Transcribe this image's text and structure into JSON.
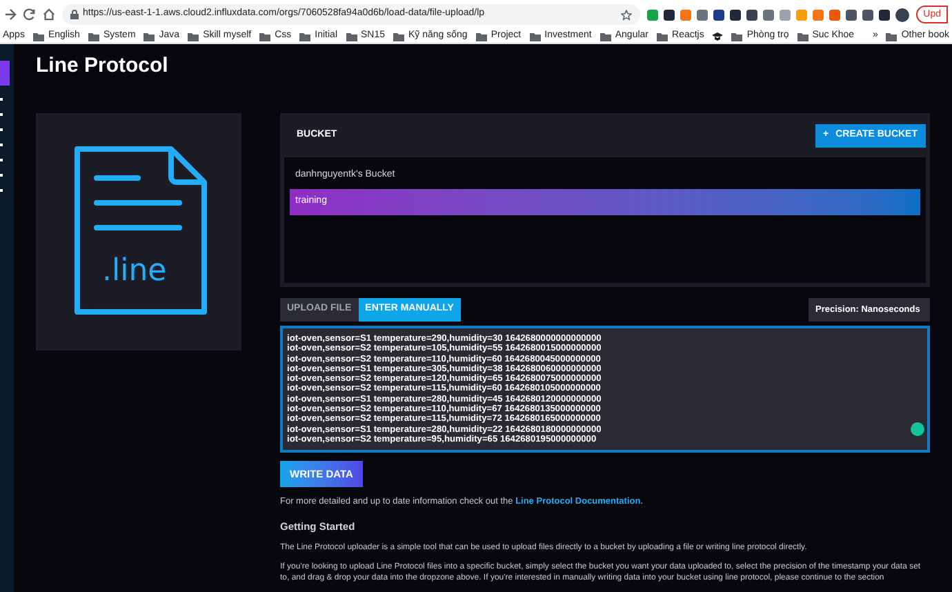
{
  "browser": {
    "url": "https://us-east-1-1.aws.cloud2.influxdata.com/orgs/7060528fa94a0d6b/load-data/file-upload/lp",
    "update_label": "Upd",
    "bookmarks": [
      {
        "label": "Apps",
        "kind": "apps"
      },
      {
        "label": "English",
        "kind": "folder"
      },
      {
        "label": "System",
        "kind": "folder"
      },
      {
        "label": "Java",
        "kind": "folder"
      },
      {
        "label": "Skill myself",
        "kind": "folder"
      },
      {
        "label": "Css",
        "kind": "folder"
      },
      {
        "label": "Initial",
        "kind": "folder"
      },
      {
        "label": "SN15",
        "kind": "folder"
      },
      {
        "label": "Kỹ năng sống",
        "kind": "folder"
      },
      {
        "label": "Project",
        "kind": "folder"
      },
      {
        "label": "Investment",
        "kind": "folder"
      },
      {
        "label": "Angular",
        "kind": "folder"
      },
      {
        "label": "Reactjs",
        "kind": "folder"
      },
      {
        "kind": "cap"
      },
      {
        "label": "Phòng trọ",
        "kind": "folder"
      },
      {
        "label": "Suc Khoe",
        "kind": "folder"
      }
    ],
    "overflow": "»",
    "other_bookmarks": "Other book"
  },
  "page": {
    "title": "Line Protocol",
    "file_label": ".line",
    "bucket": {
      "heading": "BUCKET",
      "create_button": "CREATE BUCKET",
      "create_icon": "+",
      "items": [
        {
          "label": "danhnguyentk's Bucket",
          "selected": false
        },
        {
          "label": "training",
          "selected": true
        }
      ]
    },
    "tabs": [
      {
        "label": "UPLOAD FILE",
        "selected": false
      },
      {
        "label": "ENTER MANUALLY",
        "selected": true
      }
    ],
    "precision": "Precision: Nanoseconds",
    "lines": [
      "iot-oven,sensor=S1 temperature=290,humidity=30 1642680000000000000",
      "iot-oven,sensor=S2 temperature=105,humidity=55 1642680015000000000",
      "iot-oven,sensor=S2 temperature=110,humidity=60 1642680045000000000",
      "iot-oven,sensor=S1 temperature=305,humidity=38 1642680060000000000",
      "iot-oven,sensor=S2 temperature=120,humidity=65 1642680075000000000",
      "iot-oven,sensor=S2 temperature=115,humidity=60 1642680105000000000",
      "iot-oven,sensor=S1 temperature=280,humidity=45 1642680120000000000",
      "iot-oven,sensor=S2 temperature=110,humidity=67 1642680135000000000",
      "iot-oven,sensor=S2 temperature=115,humidity=72 1642680165000000000",
      "iot-oven,sensor=S1 temperature=280,humidity=22 1642680180000000000",
      "iot-oven,sensor=S2 temperature=95,humidity=65 1642680195000000000"
    ],
    "write_button": "WRITE DATA",
    "info_text": "For more detailed and up to date information check out the",
    "info_link": "Line Protocol Documentation",
    "info_end": ".",
    "getting_started": "Getting Started",
    "paragraphs": [
      "The Line Protocol uploader is a simple tool that can be used to upload files directly to a bucket by uploading a file or writing line protocol directly.",
      "If you're looking to upload Line Protocol files into a specific bucket, simply select the bucket you want your data uploaded to, select the precision of the timestamp your data set to, and drag & drop your data into the dropzone above. If you're interested in manually writing data into your bucket using line protocol, please continue to the section"
    ]
  }
}
